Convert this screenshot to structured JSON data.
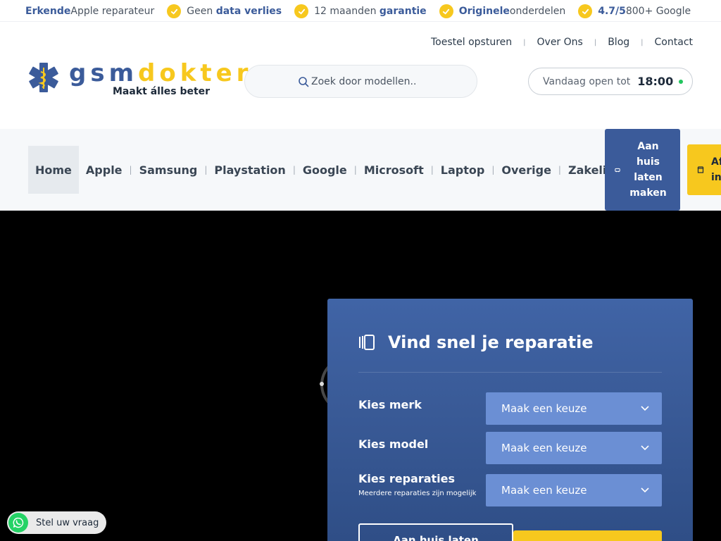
{
  "usp_bar": [
    {
      "pre": "",
      "strong": "Erkende",
      "post": " Apple reparateur"
    },
    {
      "pre": "Geen ",
      "strong": "data verlies",
      "post": ""
    },
    {
      "pre": "12 maanden ",
      "strong": "garantie",
      "post": ""
    },
    {
      "pre": "",
      "strong": "Originele",
      "post": " onderdelen"
    },
    {
      "pre": "",
      "strong": "4.7/5",
      "post": " 800+ Google"
    }
  ],
  "top_links": [
    "Toestel opsturen",
    "Over Ons",
    "Blog",
    "Contact"
  ],
  "logo": {
    "gsm": "gsm",
    "dokter": "dokter",
    "slogan": "Maakt álles beter"
  },
  "search": {
    "placeholder": "Zoek door modellen.."
  },
  "hours": {
    "label": "Vandaag open tot",
    "time": "18:00"
  },
  "nav": {
    "items": [
      "Home",
      "Apple",
      "Samsung",
      "Playstation",
      "Google",
      "Microsoft",
      "Laptop",
      "Overige",
      "Zakelijk"
    ],
    "home_button": "Aan huis laten maken",
    "yellow_button": "Af in"
  },
  "finder": {
    "title": "Vind snel je reparatie",
    "brand_label": "Kies merk",
    "model_label": "Kies model",
    "repairs_label": "Kies reparaties",
    "repairs_sub": "Meerdere reparaties zijn mogelijk",
    "select_placeholder": "Maak een keuze",
    "outline_button": "Aan huis laten"
  },
  "whatsapp": {
    "label": "Stel uw vraag"
  },
  "colors": {
    "brand_blue": "#3b5b9a",
    "brand_yellow": "#f7c81e",
    "whatsapp_green": "#25d366"
  }
}
